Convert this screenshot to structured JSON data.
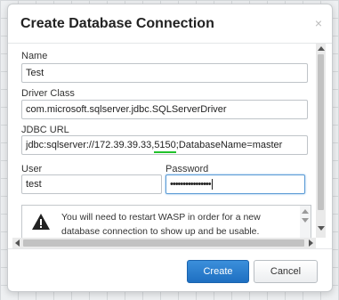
{
  "dialog": {
    "title": "Create Database Connection",
    "close_symbol": "×"
  },
  "form": {
    "name": {
      "label": "Name",
      "value": "Test"
    },
    "driver_class": {
      "label": "Driver Class",
      "value": "com.microsoft.sqlserver.jdbc.SQLServerDriver"
    },
    "jdbc_url": {
      "label": "JDBC URL",
      "value_prefix": "jdbc:sqlserver://172.39.39.33,",
      "value_highlight": "5150",
      "value_suffix": ";DatabaseName=master"
    },
    "user": {
      "label": "User",
      "value": "test"
    },
    "password": {
      "label": "Password",
      "masked_value": "••••••••••••••••"
    }
  },
  "warning": {
    "icon": "warning-triangle-icon",
    "text": "You will need to restart WASP in order for a new database connection to show up and be usable."
  },
  "buttons": {
    "create_label": "Create",
    "cancel_label": "Cancel"
  },
  "colors": {
    "primary": "#1e6fc1",
    "highlight_underline": "#22c22c",
    "focus_border": "#5b9bd5"
  }
}
